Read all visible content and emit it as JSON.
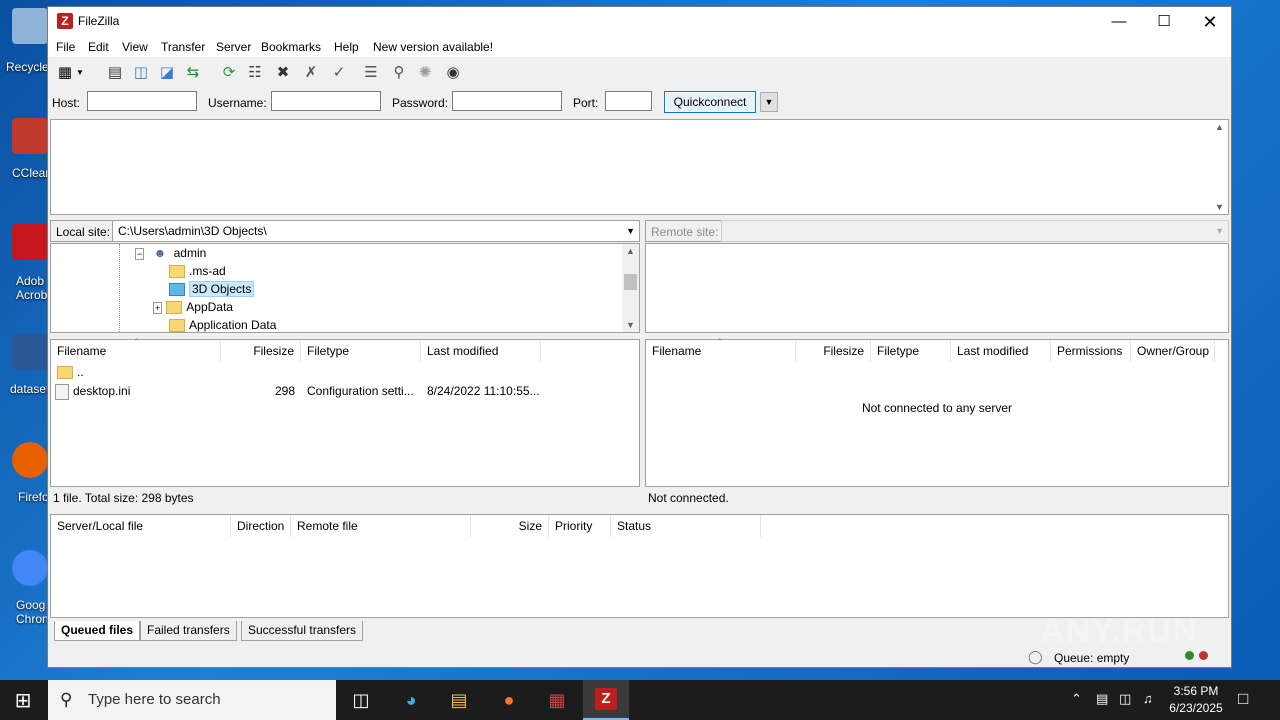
{
  "desktop": {
    "icons": [
      {
        "label": "Recycle",
        "color": "#8fb3d9"
      },
      {
        "label": "CClear",
        "color": "#c0392b"
      },
      {
        "label": "Adob\nAcrob",
        "color": "#c4161c"
      },
      {
        "label": "dataset",
        "color": "#2b5797"
      },
      {
        "label": "Firefo",
        "color": "#e66000"
      },
      {
        "label": "Goog\nChron",
        "color": "#4285f4"
      }
    ]
  },
  "window": {
    "title": "FileZilla",
    "menu": [
      "File",
      "Edit",
      "View",
      "Transfer",
      "Server",
      "Bookmarks",
      "Help",
      "New version available!"
    ]
  },
  "quickconnect": {
    "host_label": "Host:",
    "host_value": "",
    "username_label": "Username:",
    "username_value": "",
    "password_label": "Password:",
    "password_value": "",
    "port_label": "Port:",
    "port_value": "",
    "button": "Quickconnect"
  },
  "local": {
    "site_label": "Local site:",
    "path": "C:\\Users\\admin\\3D Objects\\",
    "tree": [
      {
        "label": "admin",
        "icon": "user-icon"
      },
      {
        "label": ".ms-ad",
        "icon": "folder-icon"
      },
      {
        "label": "3D Objects",
        "icon": "3d-objects-icon",
        "selected": true
      },
      {
        "label": "AppData",
        "icon": "folder-icon"
      },
      {
        "label": "Application Data",
        "icon": "folder-icon"
      }
    ],
    "columns": [
      "Filename",
      "Filesize",
      "Filetype",
      "Last modified"
    ],
    "files": [
      {
        "name": "..",
        "size": "",
        "type": "",
        "modified": ""
      },
      {
        "name": "desktop.ini",
        "size": "298",
        "type": "Configuration setti...",
        "modified": "8/24/2022 11:10:55..."
      }
    ],
    "status": "1 file. Total size: 298 bytes"
  },
  "remote": {
    "site_label": "Remote site:",
    "columns": [
      "Filename",
      "Filesize",
      "Filetype",
      "Last modified",
      "Permissions",
      "Owner/Group"
    ],
    "empty_message": "Not connected to any server",
    "status": "Not connected."
  },
  "queue": {
    "columns": [
      "Server/Local file",
      "Direction",
      "Remote file",
      "Size",
      "Priority",
      "Status"
    ],
    "tabs": [
      "Queued files",
      "Failed transfers",
      "Successful transfers"
    ],
    "status": "Queue: empty"
  },
  "taskbar": {
    "search_placeholder": "Type here to search",
    "time": "3:56 PM",
    "date": "6/23/2025"
  },
  "watermark": "ANY.RUN"
}
